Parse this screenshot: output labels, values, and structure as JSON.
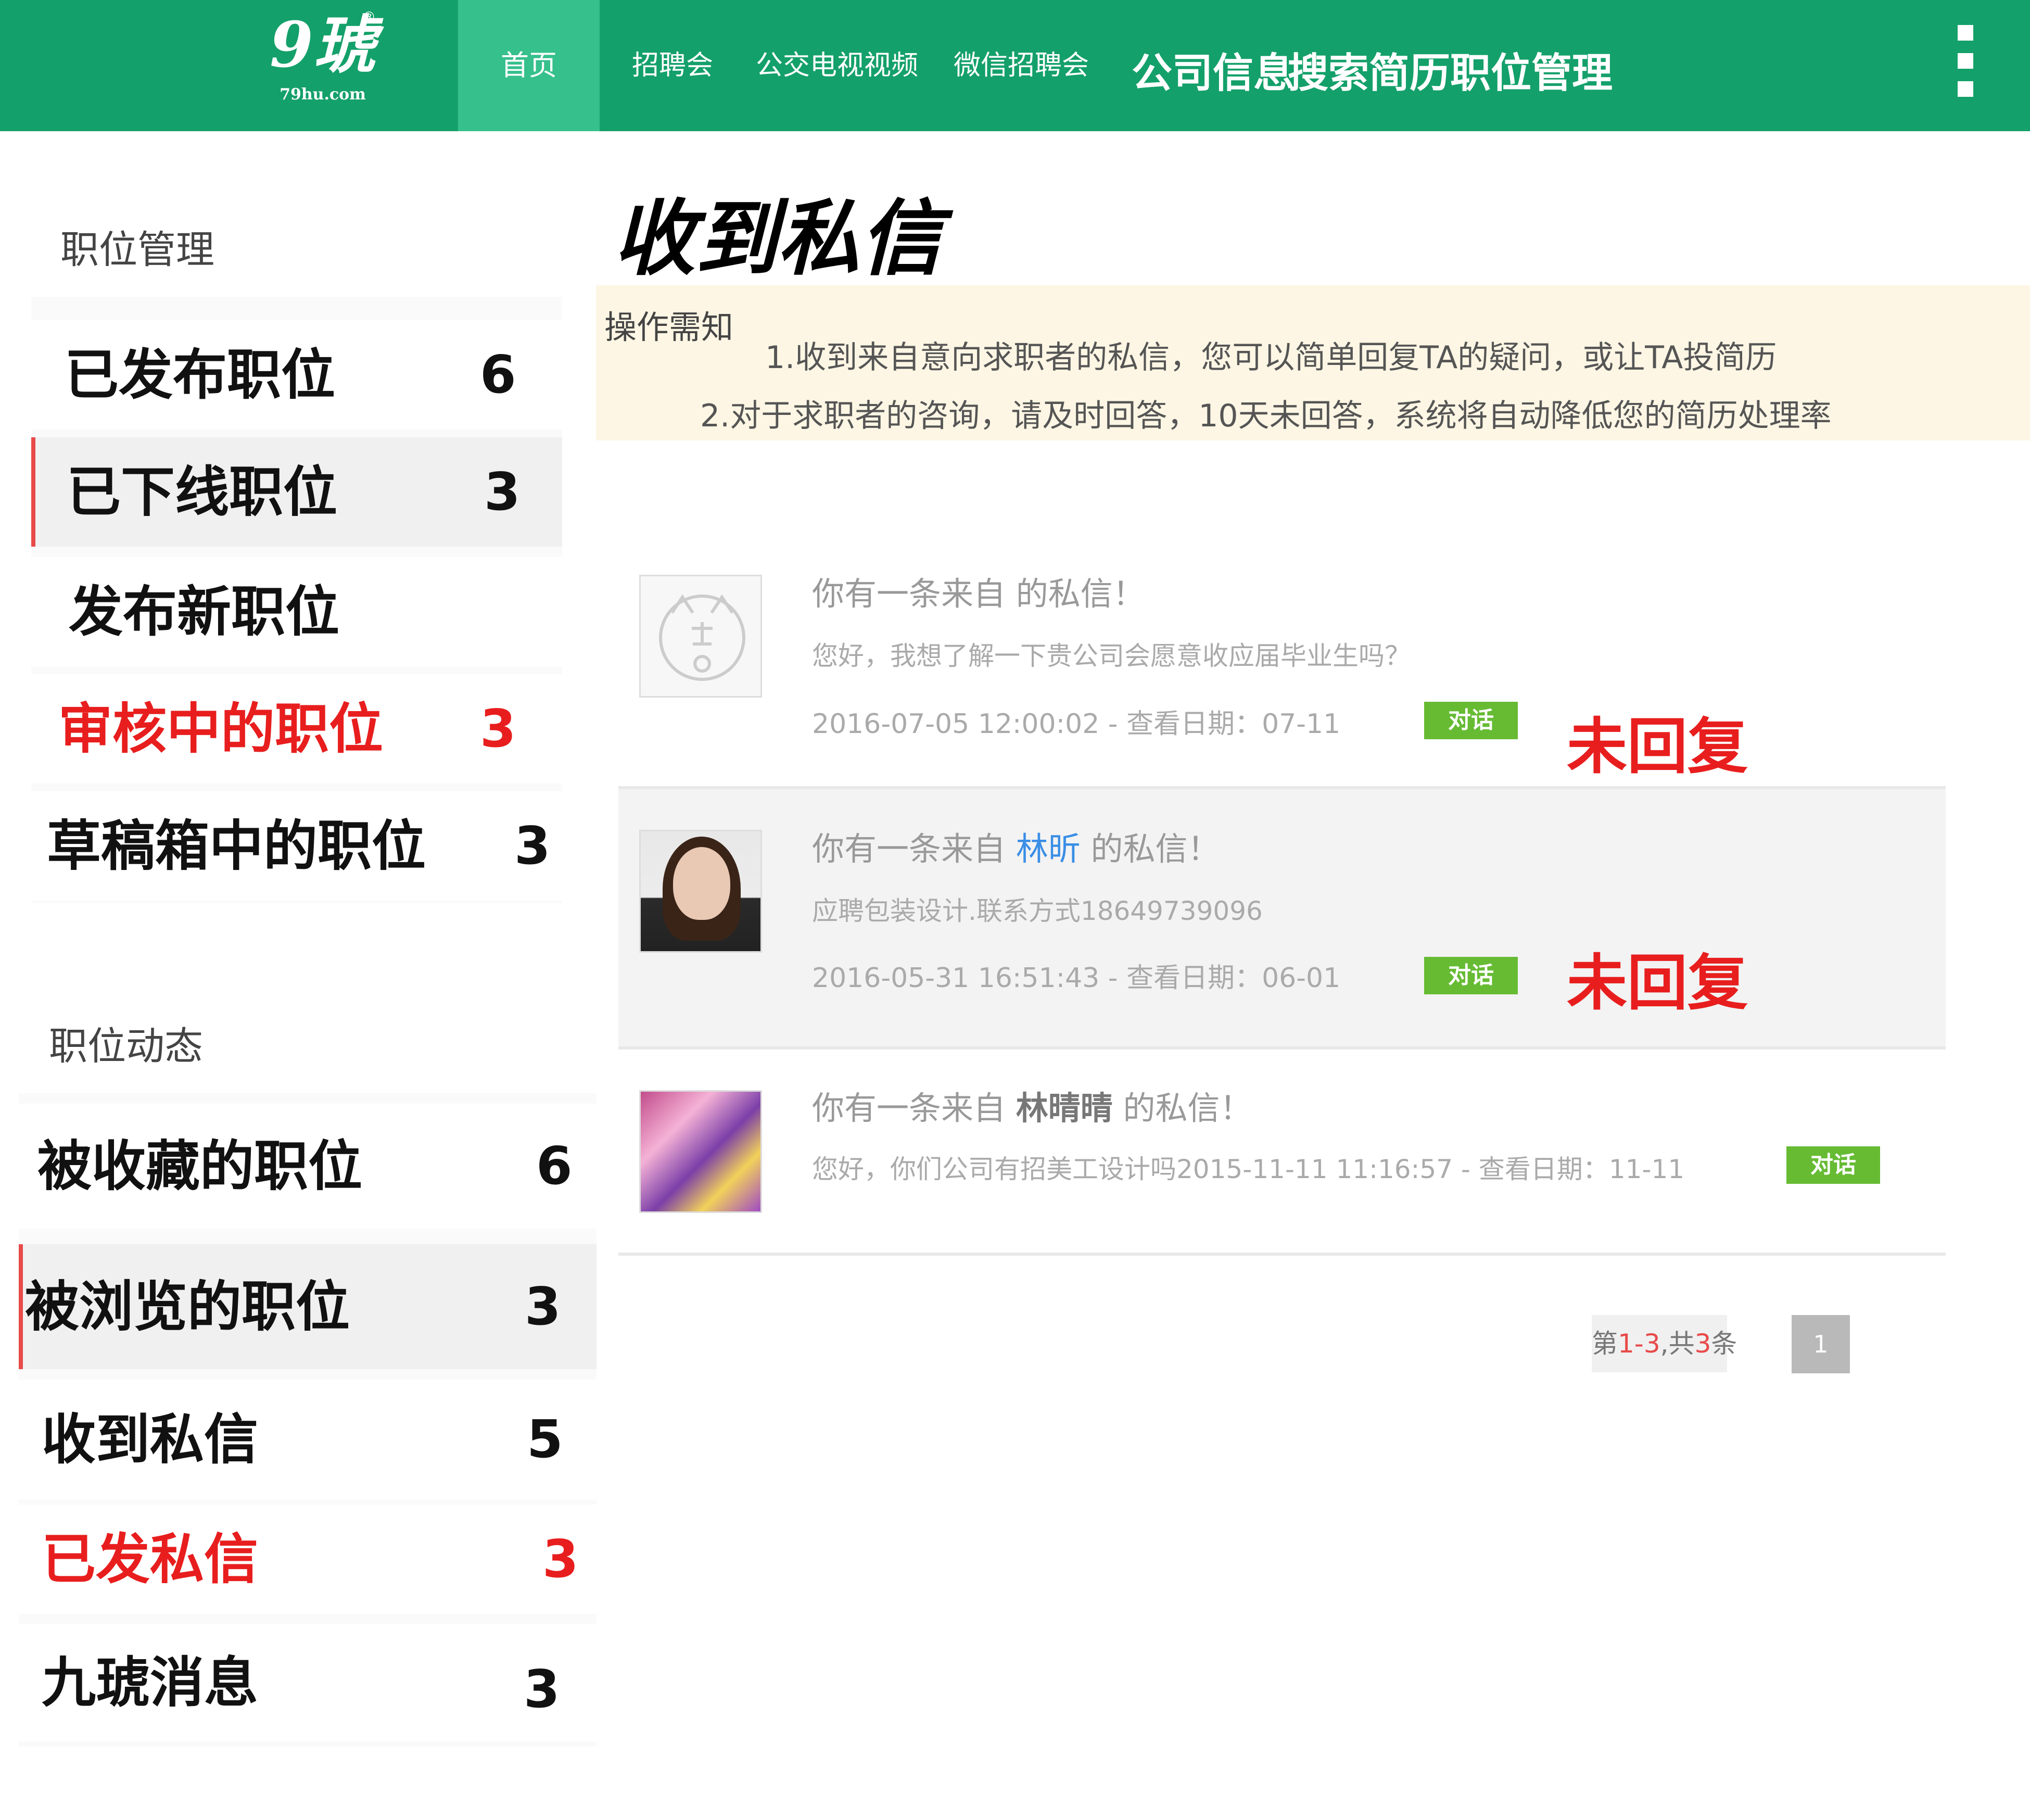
{
  "header": {
    "logo_main": "9琥",
    "logo_sub": "79hu.com",
    "logo_reg": "®",
    "nav": {
      "home": "首页",
      "job_fair": "招聘会",
      "bus_tv": "公交电视视频",
      "wechat_fair": "微信招聘会",
      "company_info": "公司信息",
      "search_resume": "搜索简历",
      "job_manage": "职位管理"
    }
  },
  "sidebar": {
    "section1": {
      "title": "职位管理",
      "items": [
        {
          "label": "已发布职位",
          "count": "6"
        },
        {
          "label": "已下线职位",
          "count": "3"
        },
        {
          "label": "发布新职位",
          "count": ""
        },
        {
          "label": "审核中的职位",
          "count": "3"
        },
        {
          "label": "草稿箱中的职位",
          "count": "3"
        }
      ]
    },
    "section2": {
      "title": "职位动态",
      "items": [
        {
          "label": "被收藏的职位",
          "count": "6"
        },
        {
          "label": "被浏览的职位",
          "count": "3"
        },
        {
          "label": "收到私信",
          "count": "5"
        },
        {
          "label": "已发私信",
          "count": "3"
        },
        {
          "label": "九琥消息",
          "count": "3"
        }
      ]
    }
  },
  "main": {
    "title": "收到私信",
    "notice": {
      "title": "操作需知",
      "line1": "1.收到来自意向求职者的私信，您可以简单回复TA的疑问，或让TA投简历",
      "line2": "2.对于求职者的咨询，请及时回答，10天未回答，系统将自动降低您的简历处理率"
    },
    "messages": [
      {
        "title_prefix": "你有一条来自",
        "sender": "",
        "title_suffix": " 的私信！",
        "body": "您好，我想了解一下贵公司会愿意收应届毕业生吗？",
        "meta": "2016-07-05 12:00:02 - 查看日期：07-11",
        "button": "对话",
        "status": "未回复",
        "avatar_icon": "tiger-avatar-icon"
      },
      {
        "title_prefix": "你有一条来自 ",
        "sender": "林昕",
        "title_suffix": " 的私信！",
        "body": "应聘包装设计.联系方式18649739096",
        "meta": "2016-05-31 16:51:43 - 查看日期：06-01",
        "button": "对话",
        "status": "未回复",
        "avatar_icon": "woman-photo-avatar"
      },
      {
        "title_prefix": "你有一条来自 ",
        "sender": "林晴晴",
        "title_suffix": " 的私信！",
        "body_meta": "您好，你们公司有招美工设计吗2015-11-11 11:16:57 - 查看日期：11-11",
        "button": "对话",
        "avatar_icon": "colorful-photo-avatar"
      }
    ],
    "pagination": {
      "prefix": "第",
      "range": "1-3",
      "mid": ",共",
      "total": "3",
      "suffix": "条",
      "page": "1"
    }
  },
  "colors": {
    "header_bg": "#14a06a",
    "nav_active_bg": "#36c08c",
    "accent_red": "#e81e1e",
    "talk_button": "#66bb33",
    "notice_bg": "#fdf6e4",
    "link_blue": "#3a8ee6"
  }
}
